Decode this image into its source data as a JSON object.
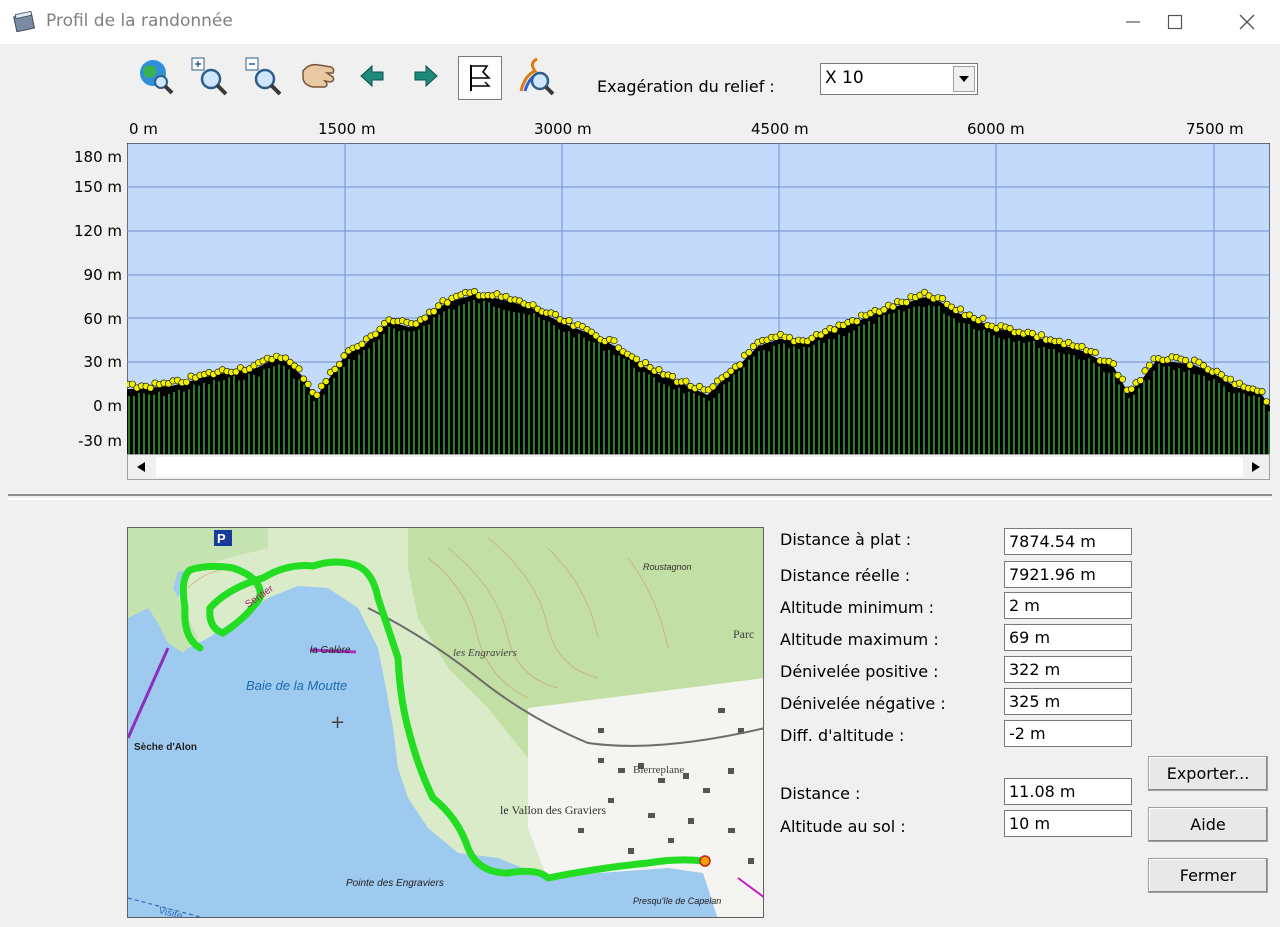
{
  "window": {
    "title": "Profil de la randonnée",
    "icon": "notebook-icon"
  },
  "toolbar": {
    "tools": [
      {
        "name": "globe-zoom-icon"
      },
      {
        "name": "zoom-in-icon"
      },
      {
        "name": "zoom-out-icon"
      },
      {
        "name": "pan-hand-icon"
      },
      {
        "name": "arrow-left-icon"
      },
      {
        "name": "arrow-right-icon"
      },
      {
        "name": "flag-icon"
      },
      {
        "name": "trail-zoom-icon"
      }
    ],
    "relief_label": "Exagération du relief :",
    "relief_value": "X 10"
  },
  "chart_data": {
    "type": "area",
    "x_unit": "m",
    "y_unit": "m",
    "x_ticks": [
      "0 m",
      "1500 m",
      "3000 m",
      "4500 m",
      "6000 m",
      "7500 m"
    ],
    "y_ticks": [
      "180 m",
      "150 m",
      "120 m",
      "90 m",
      "60 m",
      "30 m",
      "0 m",
      "-30 m"
    ],
    "xlim": [
      0,
      7874.54
    ],
    "ylim": [
      -33,
      183
    ],
    "grid": true,
    "background_color": "#c4dafa",
    "fill_color": "#000000",
    "bar_color": "#3aa33a",
    "point_color": "#f0f000",
    "x": [
      0,
      300,
      600,
      900,
      1050,
      1200,
      1300,
      1500,
      1650,
      1800,
      1950,
      2100,
      2200,
      2400,
      2600,
      2800,
      3000,
      3200,
      3400,
      3600,
      3800,
      4000,
      4200,
      4350,
      4500,
      4650,
      4800,
      5000,
      5200,
      5400,
      5500,
      5600,
      5700,
      5850,
      6000,
      6200,
      6400,
      6600,
      6800,
      6900,
      7000,
      7100,
      7200,
      7350,
      7500,
      7650,
      7800,
      7874
    ],
    "y": [
      12,
      14,
      22,
      27,
      35,
      22,
      6,
      35,
      44,
      59,
      55,
      65,
      72,
      78,
      74,
      68,
      58,
      50,
      40,
      25,
      17,
      8,
      27,
      42,
      47,
      44,
      50,
      58,
      66,
      73,
      76,
      73,
      66,
      60,
      54,
      50,
      44,
      38,
      27,
      9,
      20,
      33,
      31,
      29,
      22,
      13,
      11,
      0
    ]
  },
  "stats": [
    {
      "label": "Distance à plat :",
      "value": "7874.54 m"
    },
    {
      "label": "Distance réelle :",
      "value": "7921.96 m"
    },
    {
      "label": "Altitude minimum :",
      "value": "2 m"
    },
    {
      "label": "Altitude maximum :",
      "value": "69 m"
    },
    {
      "label": "Dénivelée positive :",
      "value": "322 m"
    },
    {
      "label": "Dénivelée négative :",
      "value": "325 m"
    },
    {
      "label": "Diff. d'altitude :",
      "value": "-2 m"
    }
  ],
  "cursor": [
    {
      "label": "Distance :",
      "value": "11.08 m"
    },
    {
      "label": "Altitude au sol :",
      "value": "10 m"
    }
  ],
  "buttons": {
    "export": "Exporter...",
    "help": "Aide",
    "close": "Fermer"
  },
  "map": {
    "labels": [
      "Baie de la Moutte",
      "la Galère",
      "les Engraviers",
      "Sèche d'Alon",
      "le Vallon des Graviers",
      "Pointe des Engraviers",
      "Presqu'île de Capelan",
      "Roustagnon",
      "Bierreplane",
      "Parc",
      "Sentier",
      "Visite"
    ]
  }
}
